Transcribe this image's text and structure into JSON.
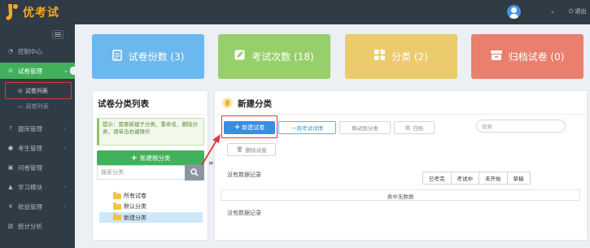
{
  "app": {
    "name": "优考试",
    "logout_label": "退出"
  },
  "sidebar": {
    "items": [
      {
        "label": "控制中心",
        "icon": "dashboard-icon"
      },
      {
        "label": "试卷管理",
        "icon": "check-circle-icon",
        "active": true
      },
      {
        "label": "题库管理",
        "icon": "question-icon"
      },
      {
        "label": "考生管理",
        "icon": "user-icon"
      },
      {
        "label": "问卷管理",
        "icon": "clipboard-icon"
      },
      {
        "label": "学习模块",
        "icon": "graduation-icon"
      },
      {
        "label": "收益管理",
        "icon": "money-icon"
      },
      {
        "label": "统计分析",
        "icon": "chart-icon"
      }
    ],
    "sub_items": [
      {
        "label": "试卷列表",
        "current": true
      },
      {
        "label": "阅卷列表"
      }
    ]
  },
  "stats": [
    {
      "label": "试卷份数 (3)",
      "icon": "document-icon",
      "color": "#6bb8ee"
    },
    {
      "label": "考试次数 (18)",
      "icon": "edit-icon",
      "color": "#97cf6a"
    },
    {
      "label": "分类 (2)",
      "icon": "grid-icon",
      "color": "#ebcb6b"
    },
    {
      "label": "归档试卷 (0)",
      "icon": "archive-icon",
      "color": "#ea7f6e"
    }
  ],
  "category_panel": {
    "title": "试卷分类列表",
    "tip": "提示：需要新建子分类、重命名、删除分类，请单击右键操作",
    "new_root_button": "新建根分类",
    "search_placeholder": "搜索分类",
    "tree": [
      {
        "label": "所有试卷"
      },
      {
        "label": "默认分类"
      },
      {
        "label": "新建分类",
        "selected": true
      }
    ]
  },
  "main_panel": {
    "title": "新建分类",
    "toolbar": {
      "new_exam": "新建试卷",
      "exam_detail": "一周考试详情",
      "move_to_category": "移动到分类",
      "archive": "归档",
      "delete_exam": "删除试卷"
    },
    "search_placeholder": "搜索",
    "no_records_top": "没有数据记录",
    "filters": [
      "已考完",
      "考试中",
      "未开始",
      "草稿"
    ],
    "table_empty": "表中无数据",
    "no_records_bottom": "没有数据记录"
  },
  "annotation_colors": {
    "highlight": "#e0353b",
    "accent": "#43b05c",
    "primary": "#3b8de0"
  }
}
